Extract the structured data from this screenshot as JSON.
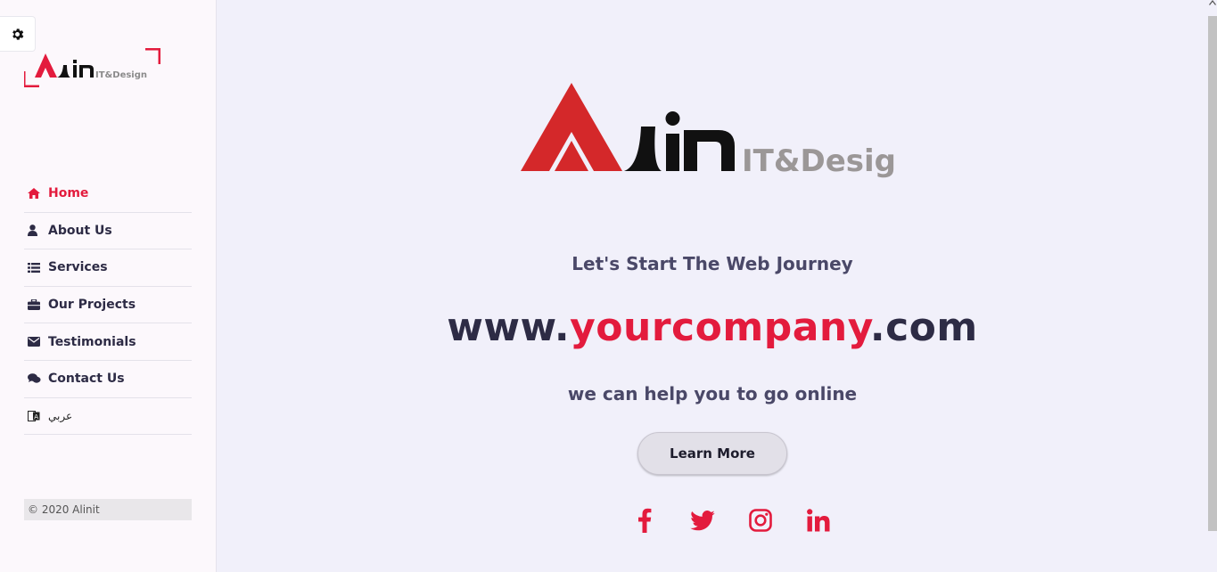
{
  "brand": {
    "name": "ALin",
    "tag": "IT&Design"
  },
  "sidebar": {
    "nav": [
      {
        "label": "Home",
        "icon": "home-icon",
        "active": true
      },
      {
        "label": "About Us",
        "icon": "user-icon"
      },
      {
        "label": "Services",
        "icon": "list-icon"
      },
      {
        "label": "Our Projects",
        "icon": "briefcase-icon"
      },
      {
        "label": "Testimonials",
        "icon": "envelope-icon"
      },
      {
        "label": "Contact Us",
        "icon": "comments-icon"
      },
      {
        "label": "عربي",
        "icon": "language-icon"
      }
    ],
    "copyright": "© 2020 Alinit"
  },
  "hero": {
    "tagline": "Let's Start The Web Journey",
    "domain_prefix": "www.",
    "domain_accent": "yourcompany",
    "domain_suffix": ".com",
    "subline": "we can help you to go online",
    "cta_label": "Learn More",
    "social": [
      "facebook-icon",
      "twitter-icon",
      "instagram-icon",
      "linkedin-icon"
    ]
  },
  "colors": {
    "accent": "#e31b3d",
    "dark": "#2d2b45",
    "muted": "#4a4868",
    "background": "#f1f0fa",
    "sidebar": "#fcf8fc"
  }
}
